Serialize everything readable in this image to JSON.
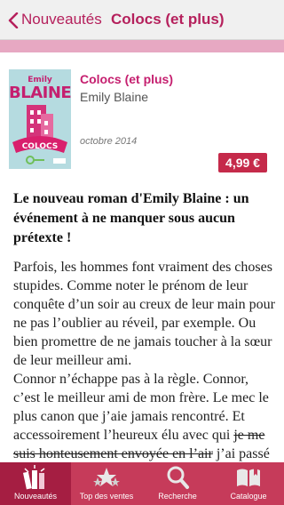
{
  "navbar": {
    "back_label": "Nouveautés",
    "title": "Colocs (et plus)"
  },
  "book": {
    "cover": {
      "author_first": "Emily",
      "author_last": "BLAINE"
    },
    "title": "Colocs (et plus)",
    "author": "Emily Blaine",
    "date": "octobre 2014",
    "price": "4,99 €"
  },
  "description": {
    "headline": "Le nouveau roman d'Emily Blaine : un événement à ne manquer sous aucun prétexte !",
    "paragraph_1": "Parfois, les hommes font vraiment des choses stupides. Comme noter le prénom de leur conquête d’un soir au creux de leur main pour ne pas l’oublier au réveil, par exemple. Ou bien promettre de ne jamais toucher à la sœur de leur meilleur ami.",
    "paragraph_2_before": "Connor n’échappe pas à la règle. Connor, c’est le meilleur ami de mon frère. Le mec le plus canon que j’aie jamais rencontré. Et accessoirement l’heureux élu avec qui ",
    "paragraph_2_struck": "je me suis honteusement envoyée en l’air",
    "paragraph_2_after": " j’ai passé un délicieux moment lors d’une soirée très"
  },
  "tabbar": {
    "tabs": [
      {
        "label": "Nouveautés",
        "icon": "books-icon",
        "active": true
      },
      {
        "label": "Top des ventes",
        "icon": "stars-icon",
        "active": false
      },
      {
        "label": "Recherche",
        "icon": "magnifier-icon",
        "active": false
      },
      {
        "label": "Catalogue",
        "icon": "open-book-icon",
        "active": false
      }
    ]
  },
  "colors": {
    "accent": "#c51f6f",
    "price_button": "#c52a4a",
    "tabbar": "#c63b5a",
    "tab_active": "#a51e42",
    "stripe": "#e7a8c2",
    "cover_background": "#b5dbe0"
  }
}
